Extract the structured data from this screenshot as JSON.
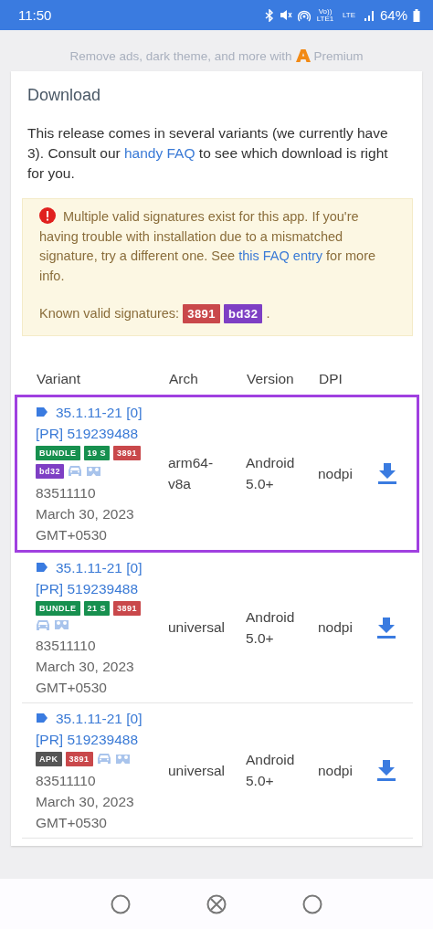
{
  "status_bar": {
    "time": "11:50",
    "network_labels": [
      "Vo)) LTE1",
      "LTE"
    ],
    "battery": "64%"
  },
  "promo": {
    "before": "Remove ads, dark theme, and more with",
    "after": "Premium"
  },
  "download": {
    "title": "Download",
    "intro": {
      "before": "This release comes in several variants (we currently have 3). Consult our ",
      "link": "handy FAQ",
      "after": " to see which download is right for you."
    },
    "warning": {
      "before": "Multiple valid signatures exist for this app. If you're having trouble with installation due to a mismatched signature, try a different one. See ",
      "link": "this FAQ entry",
      "after": " for more info.",
      "signatures_label": "Known valid signatures:",
      "signatures": [
        {
          "text": "3891",
          "color": "#c9484b"
        },
        {
          "text": "bd32",
          "color": "#7e3fc4"
        }
      ],
      "end": "."
    },
    "table": {
      "columns": [
        "Variant",
        "Arch",
        "Version",
        "DPI"
      ],
      "rows": [
        {
          "selected": true,
          "version": "35.1.11-21 [0]",
          "build": "[PR] 519239488",
          "tags": [
            {
              "text": "BUNDLE",
              "color": "#17904f"
            },
            {
              "text": "19 S",
              "color": "#17904f"
            },
            {
              "text": "3891",
              "color": "#c9484b"
            },
            {
              "text": "bd32",
              "color": "#7e3fc4"
            }
          ],
          "code": "83511110",
          "date": "March 30, 2023",
          "tz": "GMT+0530",
          "arch": "arm64-v8a",
          "min_version": "Android 5.0+",
          "dpi": "nodpi"
        },
        {
          "selected": false,
          "version": "35.1.11-21 [0]",
          "build": "[PR] 519239488",
          "tags": [
            {
              "text": "BUNDLE",
              "color": "#17904f"
            },
            {
              "text": "21 S",
              "color": "#17904f"
            },
            {
              "text": "3891",
              "color": "#c9484b"
            }
          ],
          "code": "83511110",
          "date": "March 30, 2023",
          "tz": "GMT+0530",
          "arch": "universal",
          "min_version": "Android 5.0+",
          "dpi": "nodpi"
        },
        {
          "selected": false,
          "version": "35.1.11-21 [0]",
          "build": "[PR] 519239488",
          "tags": [
            {
              "text": "APK",
              "color": "#555555"
            },
            {
              "text": "3891",
              "color": "#c9484b"
            }
          ],
          "code": "83511110",
          "date": "March 30, 2023",
          "tz": "GMT+0530",
          "arch": "universal",
          "min_version": "Android 5.0+",
          "dpi": "nodpi"
        }
      ]
    }
  }
}
